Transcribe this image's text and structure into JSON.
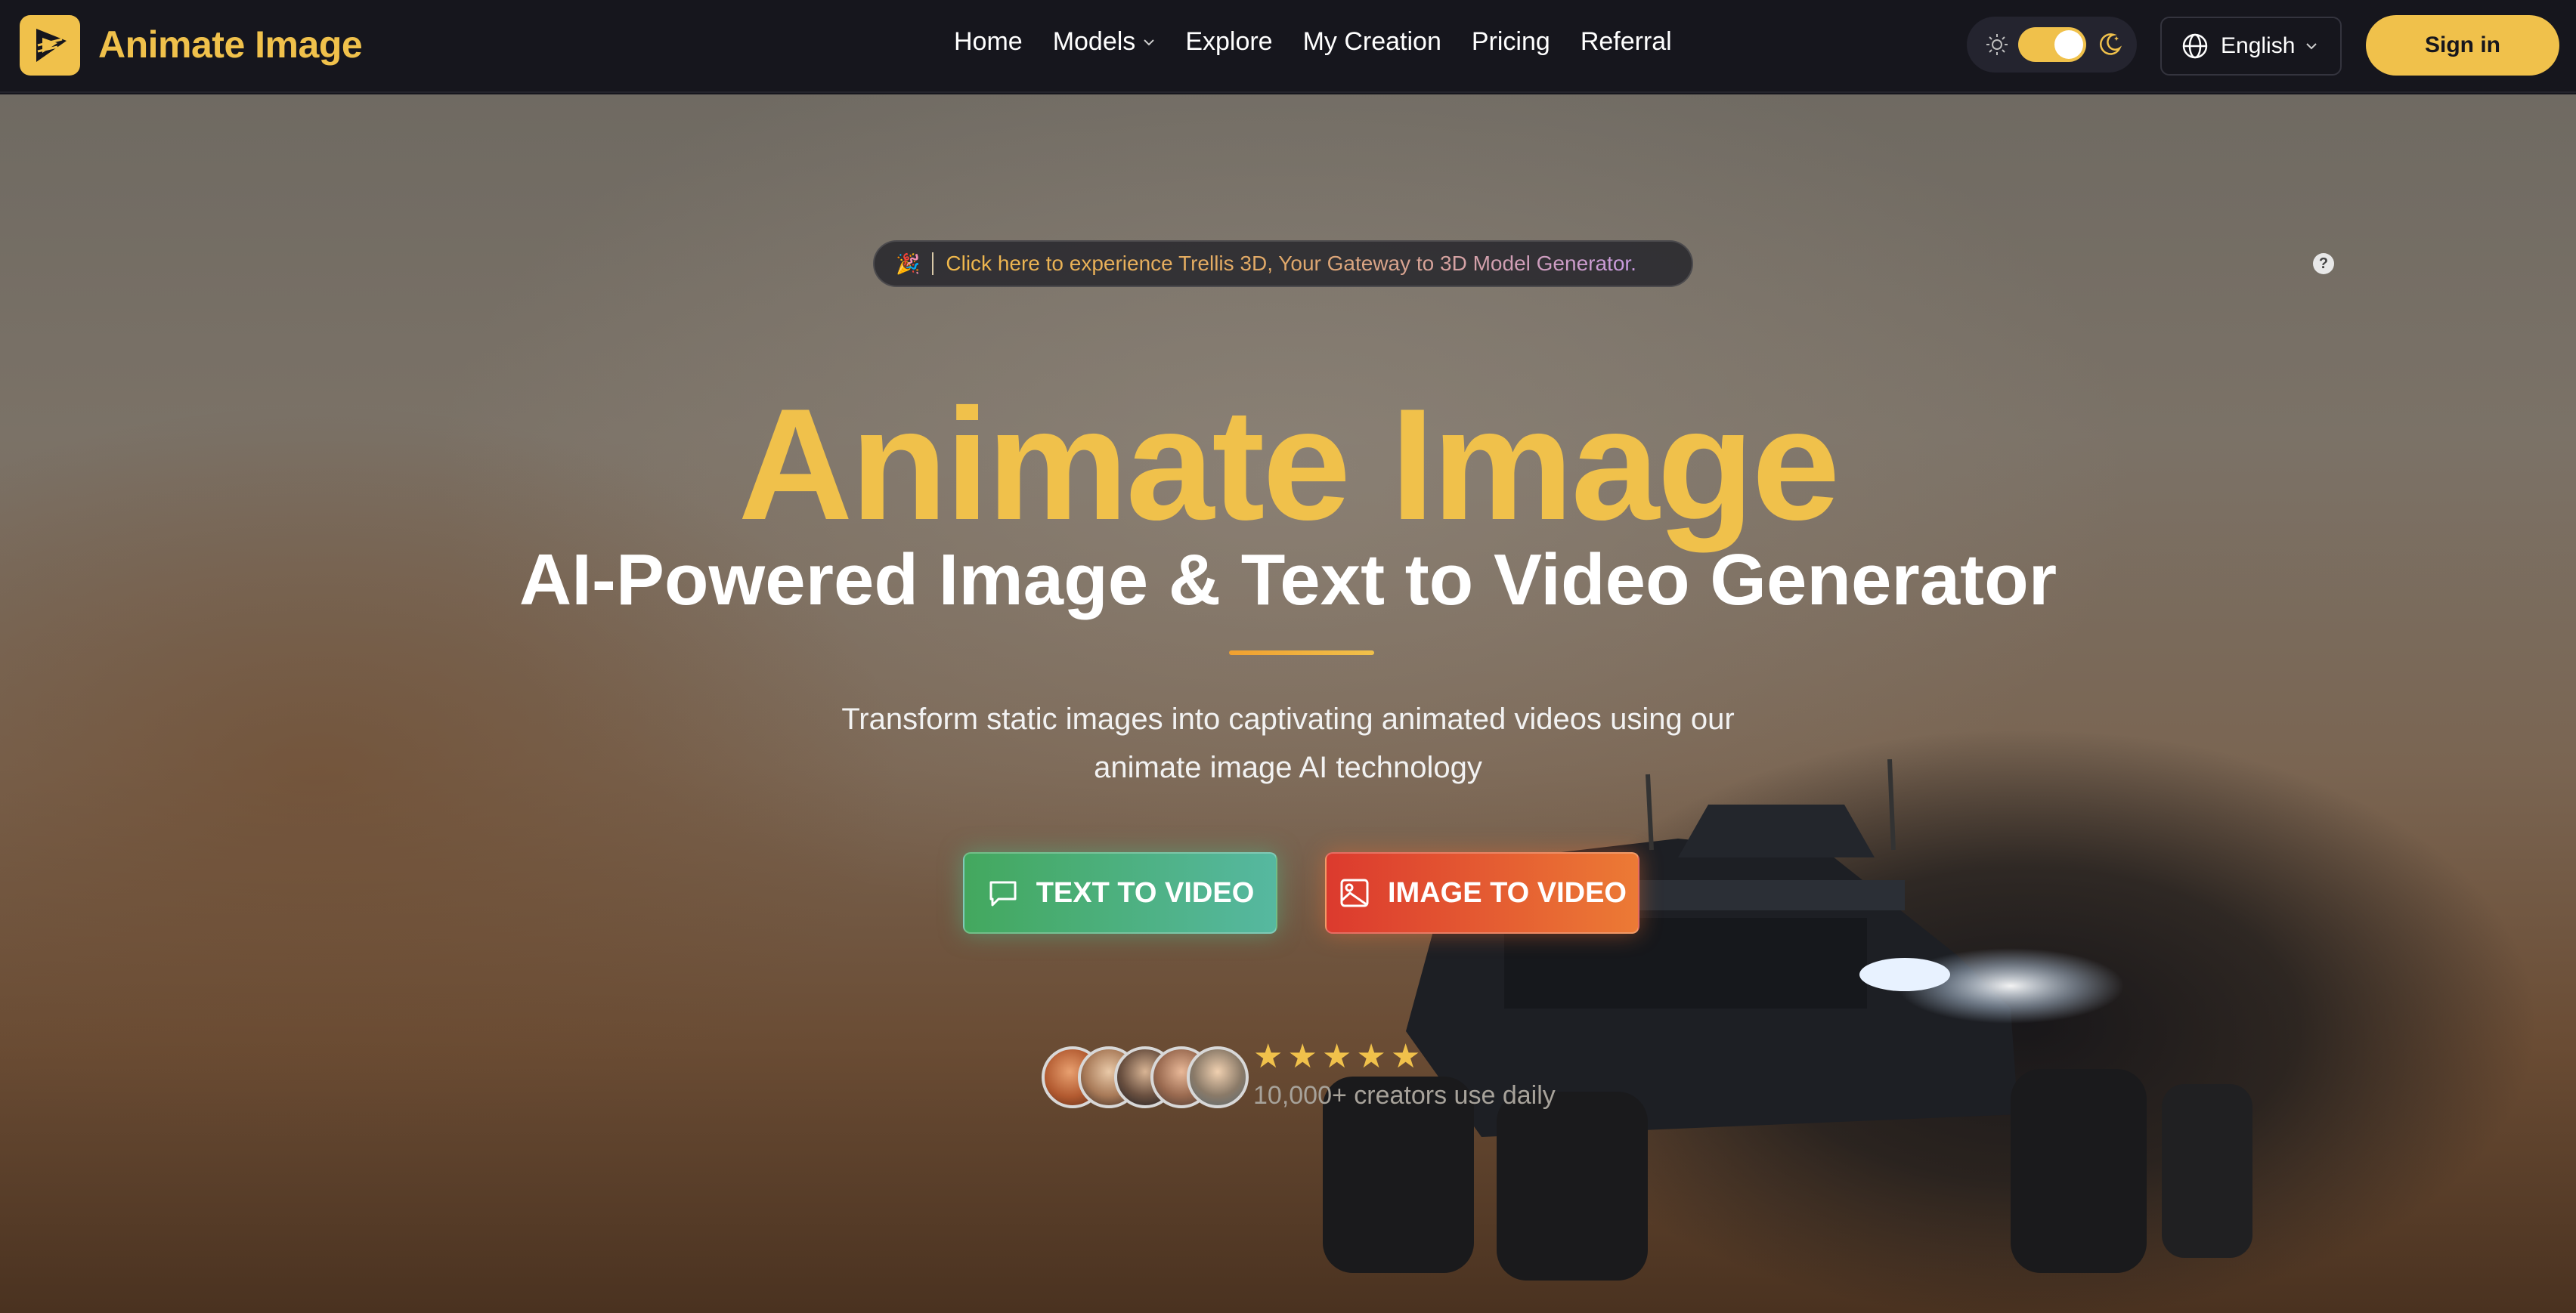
{
  "brand": {
    "name": "Animate Image",
    "accent": "#f0c14b"
  },
  "nav": {
    "links": [
      {
        "label": "Home"
      },
      {
        "label": "Models"
      },
      {
        "label": "Explore"
      },
      {
        "label": "My Creation"
      },
      {
        "label": "Pricing"
      },
      {
        "label": "Referral"
      }
    ],
    "language": "English",
    "signin": "Sign in"
  },
  "banner": {
    "emoji": "🎉",
    "text": "Click here to experience Trellis 3D, Your Gateway to 3D Model Generator."
  },
  "hero": {
    "title": "Animate Image",
    "subtitle": "AI-Powered Image & Text to Video Generator",
    "description": "Transform static images into captivating animated videos using our animate image AI technology",
    "buttons": {
      "text_to_video": "TEXT TO VIDEO",
      "image_to_video": "IMAGE TO VIDEO"
    },
    "rating_stars": 5,
    "creators": "10,000+ creators use daily"
  }
}
